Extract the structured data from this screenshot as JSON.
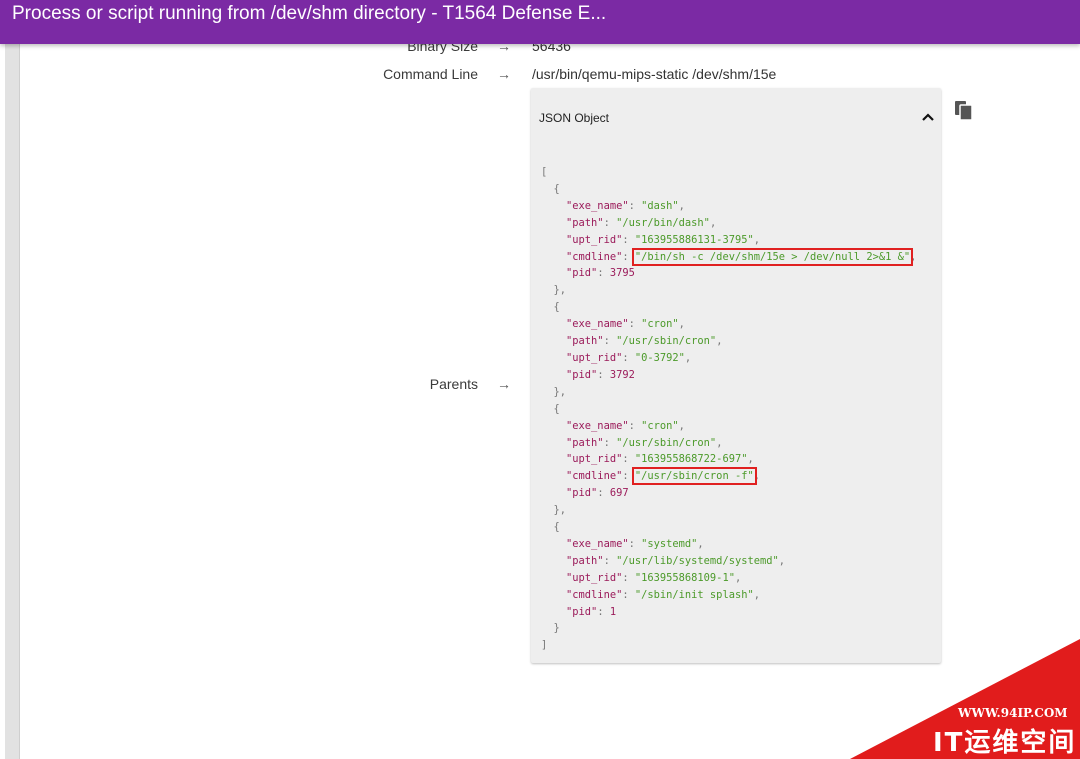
{
  "window": {
    "title": "Process or script running from /dev/shm directory - T1564 Defense E..."
  },
  "fields": [
    {
      "label": "Binary Size",
      "arrow": "→",
      "value": "56436"
    },
    {
      "label": "Command Line",
      "arrow": "→",
      "value": "/usr/bin/qemu-mips-static /dev/shm/15e"
    },
    {
      "label": "Parents",
      "arrow": "→"
    }
  ],
  "json_panel": {
    "header": "JSON Object",
    "keys": {
      "exe_name": "\"exe_name\"",
      "path": "\"path\"",
      "upt_rid": "\"upt_rid\"",
      "cmdline": "\"cmdline\"",
      "pid": "\"pid\""
    },
    "parents": [
      {
        "exe_name": "\"dash\"",
        "path": "\"/usr/bin/dash\"",
        "upt_rid": "\"163955886131-3795\"",
        "cmdline": "\"/bin/sh -c /dev/shm/15e > /dev/null 2>&1 &\"",
        "pid": "3795"
      },
      {
        "exe_name": "\"cron\"",
        "path": "\"/usr/sbin/cron\"",
        "upt_rid": "\"0-3792\"",
        "pid": "3792"
      },
      {
        "exe_name": "\"cron\"",
        "path": "\"/usr/sbin/cron\"",
        "upt_rid": "\"163955868722-697\"",
        "cmdline": "\"/usr/sbin/cron -f\"",
        "pid": "697"
      },
      {
        "exe_name": "\"systemd\"",
        "path": "\"/usr/lib/systemd/systemd\"",
        "upt_rid": "\"163955868109-1\"",
        "cmdline": "\"/sbin/init splash\"",
        "pid": "1"
      }
    ]
  },
  "watermark": {
    "url": "WWW.94IP.COM",
    "text": "IT运维空间"
  },
  "colors": {
    "titlebar": "#7b2aa4",
    "json_key": "#9b1b5a",
    "json_string": "#4c9a2a",
    "highlight": "#e02020",
    "watermark": "#e11c1c"
  }
}
